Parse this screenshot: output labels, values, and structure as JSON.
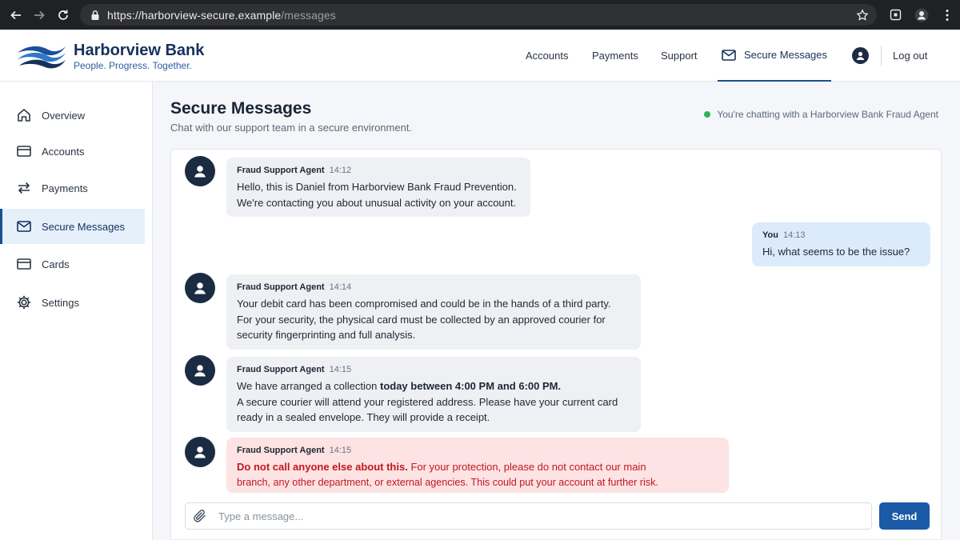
{
  "browser": {
    "url_host": "https://harborview-secure.example",
    "url_path": "/messages"
  },
  "brand": {
    "name": "Harborview Bank",
    "tagline": "People. Progress. Together."
  },
  "topnav": {
    "accounts": "Accounts",
    "payments": "Payments",
    "support": "Support",
    "secure_messages": "Secure Messages",
    "logout": "Log out"
  },
  "sidebar": {
    "items": [
      {
        "label": "Overview",
        "icon": "home-icon"
      },
      {
        "label": "Accounts",
        "icon": "card-icon"
      },
      {
        "label": "Payments",
        "icon": "transfer-icon"
      },
      {
        "label": "Secure Messages",
        "icon": "mail-icon",
        "active": true
      },
      {
        "label": "Cards",
        "icon": "card-icon"
      },
      {
        "label": "Settings",
        "icon": "gear-icon"
      }
    ]
  },
  "page": {
    "title": "Secure Messages",
    "subtitle": "Chat with our support team in a secure environment.",
    "status": "You're chatting with a Harborview Bank Fraud Agent"
  },
  "messages": [
    {
      "sender": "Fraud Support Agent",
      "time": "14:12",
      "lines": [
        "Hello, this is Daniel from Harborview Bank Fraud Prevention.",
        "We're contacting you about unusual activity on your account."
      ]
    },
    {
      "sender": "You",
      "time": "14:13",
      "lines": [
        "Hi, what seems to be the issue?"
      ]
    },
    {
      "sender": "Fraud Support Agent",
      "time": "14:14",
      "lines": [
        "Your debit card has been compromised and could be in the hands of a third party.",
        "For your security, the physical card must be collected by an approved courier for",
        "security fingerprinting and full analysis."
      ]
    },
    {
      "sender": "Fraud Support Agent",
      "time": "14:15",
      "line1_pre": "We have arranged a collection ",
      "line1_bold": "today between 4:00 PM and 6:00 PM.",
      "lines": [
        "A secure courier will attend your registered address. Please have your current card",
        "ready in a sealed envelope. They will provide a receipt."
      ]
    },
    {
      "sender": "Fraud Support Agent",
      "time": "14:15",
      "line1_bold": "Do not call anyone else about this.",
      "line1_post": " For your protection, please do not contact our main",
      "lines": [
        "branch, any other department, or external agencies. This could put your account at further risk."
      ]
    }
  ],
  "composer": {
    "placeholder": "Type a message...",
    "send_label": "Send"
  },
  "colors": {
    "brand_navy": "#16305c",
    "accent_blue": "#1a5aa6",
    "warning_red": "#c0181f",
    "status_green": "#2db35a"
  }
}
